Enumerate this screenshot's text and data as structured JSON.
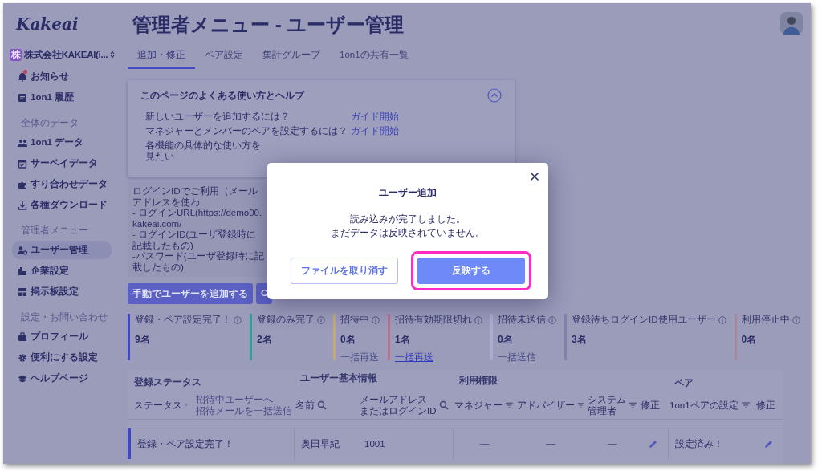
{
  "brand": {
    "logo": "Kakeai"
  },
  "company": {
    "badge": "株",
    "name": "株式会社KAKEAI(i..."
  },
  "sidebar": {
    "sections": [
      {
        "items": [
          {
            "label": "お知らせ",
            "unread": true,
            "selected": false
          },
          {
            "label": "1on1 履歴",
            "unread": false,
            "selected": false
          }
        ]
      },
      {
        "heading": "全体のデータ",
        "items": [
          {
            "label": "1on1 データ",
            "selected": false
          },
          {
            "label": "サーベイデータ",
            "selected": false
          },
          {
            "label": "すり合わせデータ",
            "selected": false
          },
          {
            "label": "各種ダウンロード",
            "selected": false
          }
        ]
      },
      {
        "heading": "管理者メニュー",
        "items": [
          {
            "label": "ユーザー管理",
            "selected": true
          },
          {
            "label": "企業設定",
            "selected": false
          },
          {
            "label": "掲示板設定",
            "selected": false
          }
        ]
      },
      {
        "heading": "設定・お問い合わせ",
        "items": [
          {
            "label": "プロフィール",
            "selected": false
          },
          {
            "label": "便利にする設定",
            "selected": false
          },
          {
            "label": "ヘルプページ",
            "selected": false
          }
        ]
      }
    ]
  },
  "page": {
    "title": "管理者メニュー - ユーザー管理"
  },
  "tabs": [
    {
      "label": "追加・修正",
      "selected": true
    },
    {
      "label": "ペア設定",
      "selected": false
    },
    {
      "label": "集計グループ",
      "selected": false
    },
    {
      "label": "1on1の共有一覧",
      "selected": false
    }
  ],
  "help": {
    "title": "このページのよくある使い方とヘルプ",
    "expanded": true,
    "rows": [
      {
        "question": "新しいユーザーを追加するには？",
        "link": "ガイド開始"
      },
      {
        "question": "マネジャーとメンバーのペアを設定するには？",
        "link": "ガイド開始"
      },
      {
        "question": "各機能の具体的な使い方を見たい"
      }
    ]
  },
  "info": {
    "lines": [
      "ログインIDでご利用（メールアドレスを使わ",
      "- ログインURL(https://demo00.kakeai.com/",
      "- ログインID(ユーザ登録時に記載したもの)",
      "-パスワード(ユーザ登録時に記載したもの)"
    ]
  },
  "actions": [
    {
      "label": "手動でユーザーを追加する"
    },
    {
      "label": "C"
    }
  ],
  "stats": [
    {
      "label": "登録・ペア設定完了！",
      "count": "9名",
      "color": "#3f46c4"
    },
    {
      "label": "登録のみ完了",
      "count": "2名",
      "color": "#3d9a93"
    },
    {
      "label": "招待中",
      "count": "0名",
      "color": "#c6aa6f",
      "link": "一括再送",
      "link_disabled": true
    },
    {
      "label": "招待有効期限切れ",
      "count": "1名",
      "color": "#c96a90",
      "link": "一括再送",
      "link_disabled": false
    },
    {
      "label": "招待未送信",
      "count": "0名",
      "color": "#a9add4",
      "link": "一括送信",
      "link_disabled": true
    },
    {
      "label": "登録待ちログインID使用ユーザー",
      "count": "3名",
      "color": "#7f82ab"
    },
    {
      "label": "利用停止中",
      "count": "0名",
      "color": "#a8879d"
    }
  ],
  "table": {
    "groups": [
      "登録ステータス",
      "ユーザー基本情報",
      "利用権限",
      "ペア"
    ],
    "bulk_link": {
      "lines": [
        "招待中ユーザーへ",
        "招待メールを一括送信"
      ],
      "disabled": true
    },
    "columns": [
      {
        "lines": [
          "ステータス"
        ],
        "kind": "filter"
      },
      {
        "lines": [
          "名前"
        ],
        "kind": "search"
      },
      {
        "lines": [
          "メールアドレス",
          "またはログインID"
        ],
        "kind": "search"
      },
      {
        "lines": [
          "マネジャー"
        ],
        "kind": "filter"
      },
      {
        "lines": [
          "アドバイザー"
        ],
        "kind": "filter"
      },
      {
        "lines": [
          "システム",
          "管理者"
        ],
        "kind": "filter"
      },
      {
        "lines": [
          "修正"
        ],
        "kind": "plain"
      },
      {
        "lines": [
          "1on1ペアの設定"
        ],
        "kind": "filter"
      },
      {
        "lines": [
          "修正"
        ],
        "kind": "plain"
      }
    ],
    "rows": [
      {
        "status": "登録・ペア設定完了！",
        "color": "#3f46c4",
        "name": "奥田早紀",
        "login_id": "1001",
        "manager": "—",
        "advisor": "—",
        "admin": "—",
        "pair": "設定済み！"
      }
    ]
  },
  "modal": {
    "title": "ユーザー追加",
    "message": [
      "読み込みが完了しました。",
      "まだデータは反映されていません。"
    ],
    "buttons": [
      {
        "label": "ファイルを取り消す",
        "kind": "secondary",
        "highlighted": false
      },
      {
        "label": "反映する",
        "kind": "primary",
        "highlighted": true
      }
    ]
  }
}
